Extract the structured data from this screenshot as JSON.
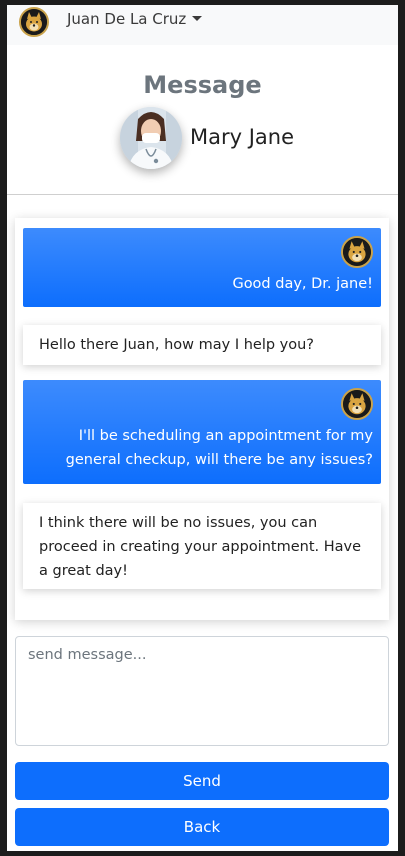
{
  "navbar": {
    "user_name": "Juan De La Cruz",
    "avatar_icon": "doge-avatar-icon"
  },
  "header": {
    "title": "Message",
    "contact_name": "Mary Jane",
    "contact_avatar": "doctor-photo"
  },
  "messages": [
    {
      "direction": "outgoing",
      "text": "Good day, Dr. jane!"
    },
    {
      "direction": "incoming",
      "text": "Hello there Juan, how may I help you?"
    },
    {
      "direction": "outgoing",
      "text": "I'll be scheduling an appointment for my general checkup, will there be any issues?"
    },
    {
      "direction": "incoming",
      "text": "I think there will be no issues, you can proceed in creating your appointment. Have a great day!"
    }
  ],
  "composer": {
    "placeholder": "send message...",
    "value": "",
    "send_label": "Send",
    "back_label": "Back"
  },
  "colors": {
    "primary": "#0d6efd",
    "outgoing_gradient_top": "#3d8bfd",
    "title_gray": "#6c757d"
  }
}
